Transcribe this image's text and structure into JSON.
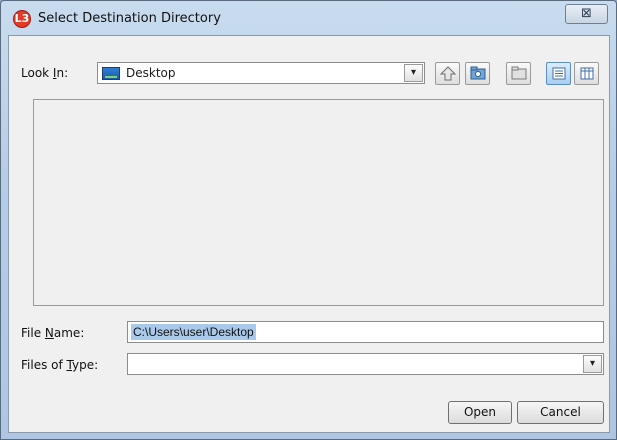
{
  "window": {
    "title": "Select Destination Directory",
    "app_icon_text": "L3",
    "close_symbol": "⊠"
  },
  "look_in": {
    "label_prefix": "Look ",
    "label_mnemonic": "I",
    "label_suffix": "n:",
    "value": "Desktop",
    "icon": "desktop-icon",
    "dropdown_symbol": "▾"
  },
  "toolbar": {
    "buttons": [
      "up-one-level-icon",
      "new-folder-icon",
      "home-folder-icon",
      "list-view-icon",
      "details-view-icon"
    ]
  },
  "file_name": {
    "label_prefix": "File ",
    "label_mnemonic": "N",
    "label_suffix": "ame:",
    "value": "C:\\Users\\user\\Desktop"
  },
  "files_of_type": {
    "label_prefix": "Files of ",
    "label_mnemonic": "T",
    "label_suffix": "ype:",
    "value": "",
    "dropdown_symbol": "▾"
  },
  "buttons": {
    "open": "Open",
    "cancel": "Cancel"
  },
  "colors": {
    "title_bar": "#b6cde6",
    "selection": "#a9c9ea",
    "app_icon": "#e23a26"
  }
}
